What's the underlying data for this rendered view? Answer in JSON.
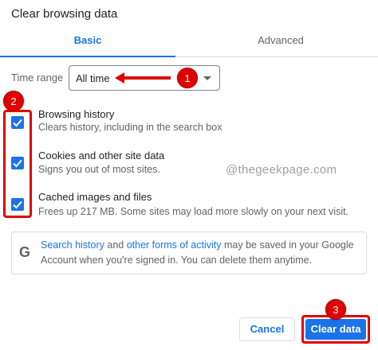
{
  "dialog": {
    "title": "Clear browsing data"
  },
  "tabs": [
    {
      "label": "Basic",
      "selected": true
    },
    {
      "label": "Advanced",
      "selected": false
    }
  ],
  "time_range": {
    "label": "Time range",
    "value": "All time"
  },
  "items": [
    {
      "title": "Browsing history",
      "description": "Clears history, including in the search box",
      "checked": true
    },
    {
      "title": "Cookies and other site data",
      "description": "Signs you out of most sites.",
      "checked": true
    },
    {
      "title": "Cached images and files",
      "description": "Frees up 217 MB. Some sites may load more slowly on your next visit.",
      "checked": true
    }
  ],
  "info": {
    "link1": "Search history",
    "text1": " and ",
    "link2": "other forms of activity",
    "text2": " may be saved in your Google",
    "line2": "Account when you're signed in. You can delete them anytime.",
    "icon": "G"
  },
  "buttons": {
    "cancel": "Cancel",
    "clear": "Clear data"
  },
  "annotations": {
    "badge1": "1",
    "badge2": "2",
    "badge3": "3"
  },
  "watermark": "@thegeekpage.com",
  "colors": {
    "accent": "#1a73e8",
    "annotation": "#e00000"
  }
}
